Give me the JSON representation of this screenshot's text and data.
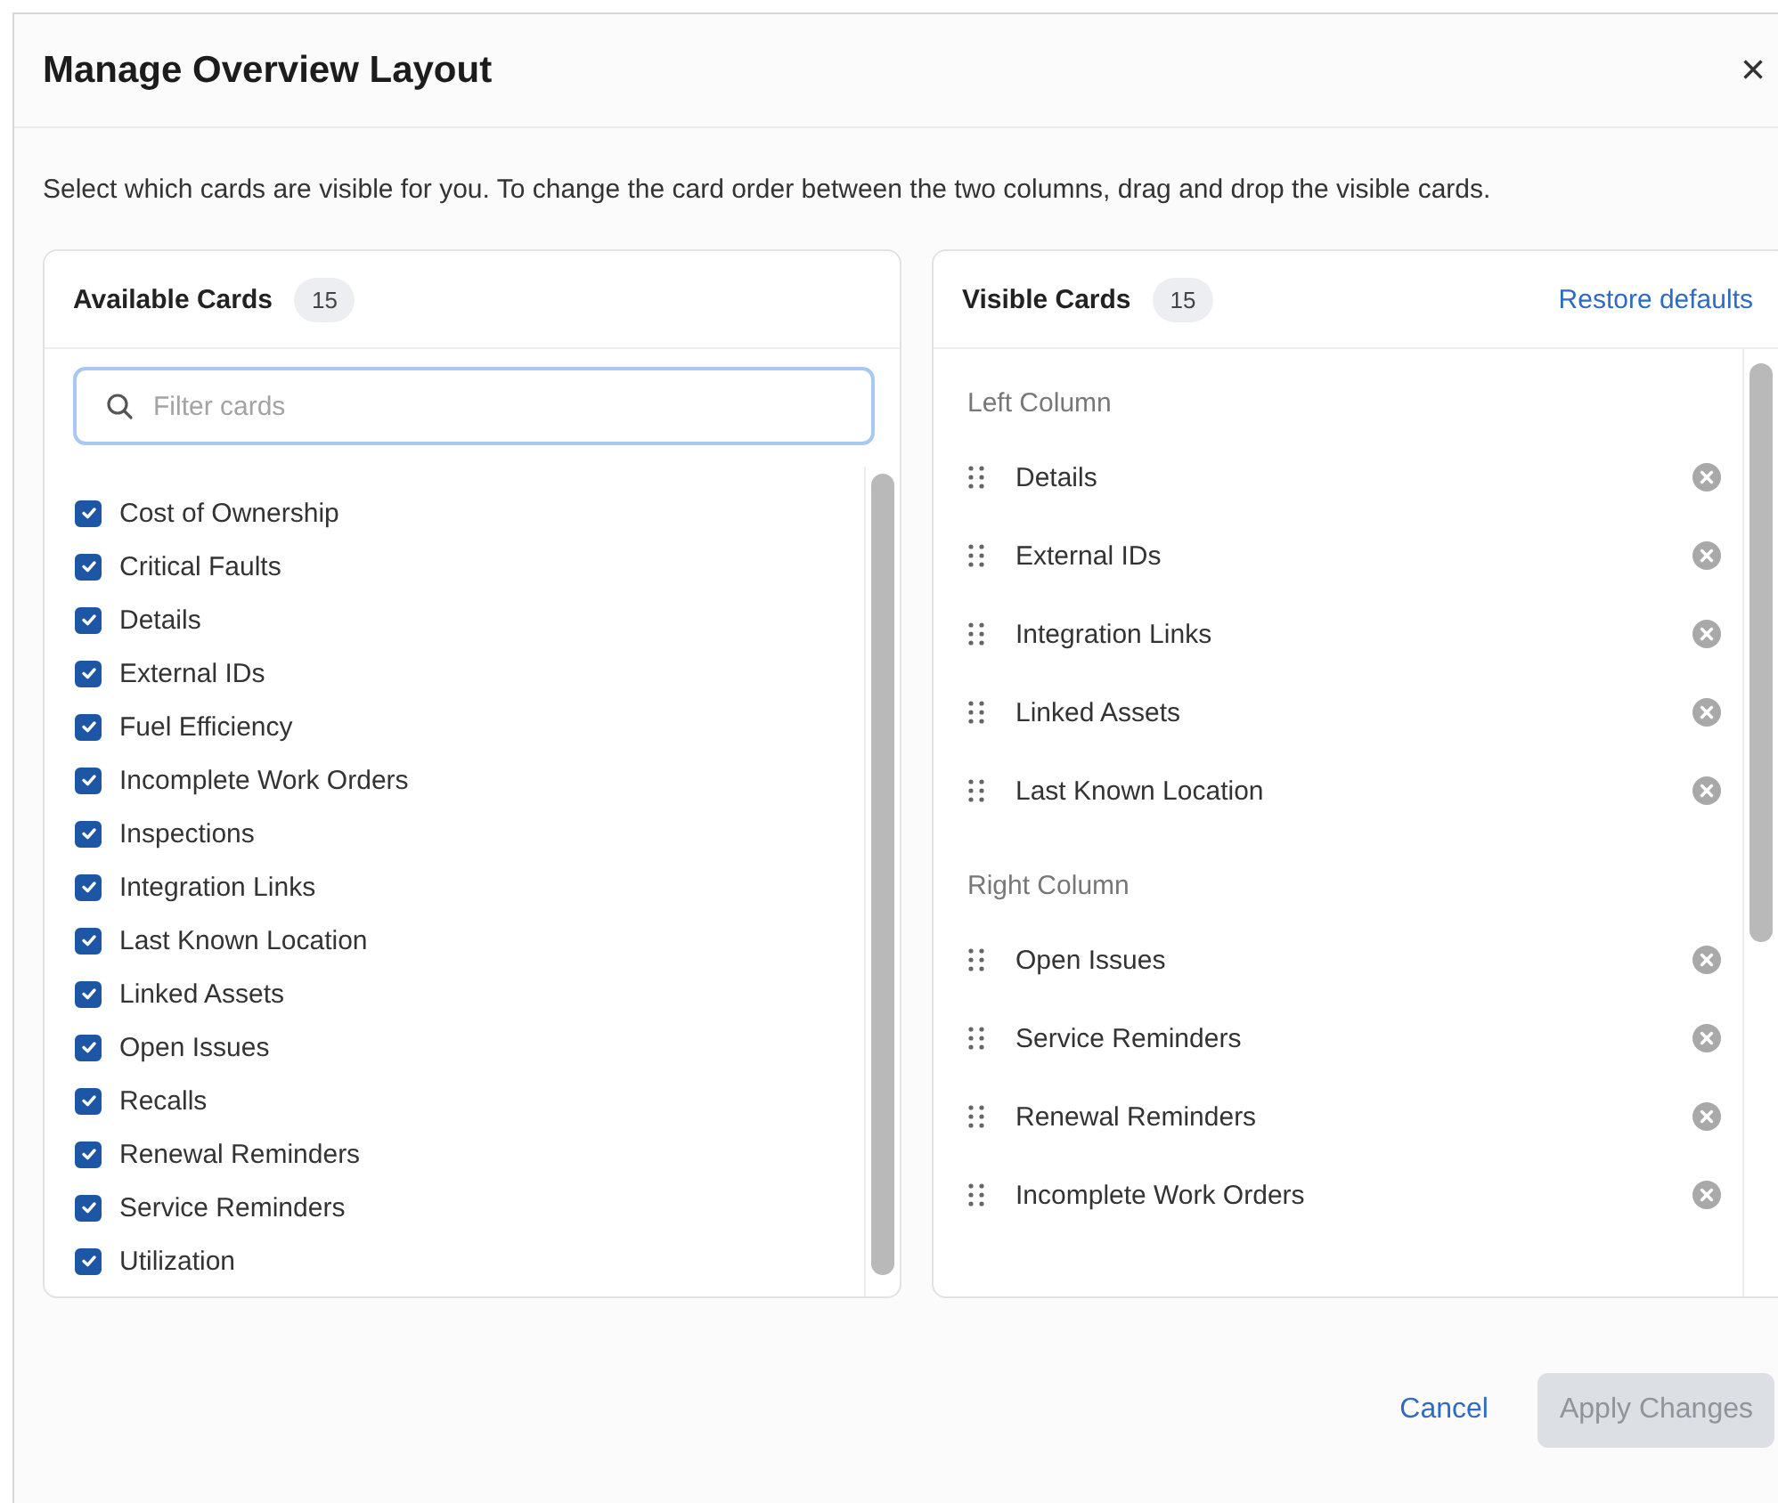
{
  "dialog": {
    "title": "Manage Overview Layout",
    "close": "×",
    "description": "Select which cards are visible for you. To change the card order between the two columns, drag and drop the visible cards."
  },
  "available": {
    "title": "Available Cards",
    "count": "15",
    "search": {
      "placeholder": "Filter cards"
    },
    "items": [
      {
        "label": "Cost of Ownership",
        "checked": true
      },
      {
        "label": "Critical Faults",
        "checked": true
      },
      {
        "label": "Details",
        "checked": true
      },
      {
        "label": "External IDs",
        "checked": true
      },
      {
        "label": "Fuel Efficiency",
        "checked": true
      },
      {
        "label": "Incomplete Work Orders",
        "checked": true
      },
      {
        "label": "Inspections",
        "checked": true
      },
      {
        "label": "Integration Links",
        "checked": true
      },
      {
        "label": "Last Known Location",
        "checked": true
      },
      {
        "label": "Linked Assets",
        "checked": true
      },
      {
        "label": "Open Issues",
        "checked": true
      },
      {
        "label": "Recalls",
        "checked": true
      },
      {
        "label": "Renewal Reminders",
        "checked": true
      },
      {
        "label": "Service Reminders",
        "checked": true
      },
      {
        "label": "Utilization",
        "checked": true
      }
    ]
  },
  "visible": {
    "title": "Visible Cards",
    "count": "15",
    "restore": "Restore defaults",
    "groups": [
      {
        "title": "Left Column",
        "items": [
          "Details",
          "External IDs",
          "Integration Links",
          "Linked Assets",
          "Last Known Location"
        ]
      },
      {
        "title": "Right Column",
        "items": [
          "Open Issues",
          "Service Reminders",
          "Renewal Reminders",
          "Incomplete Work Orders"
        ]
      }
    ]
  },
  "buttons": [
    {
      "label": "Cancel",
      "kind": "link",
      "disabled": false
    },
    {
      "label": "Apply Changes",
      "kind": "primary",
      "disabled": true
    }
  ]
}
